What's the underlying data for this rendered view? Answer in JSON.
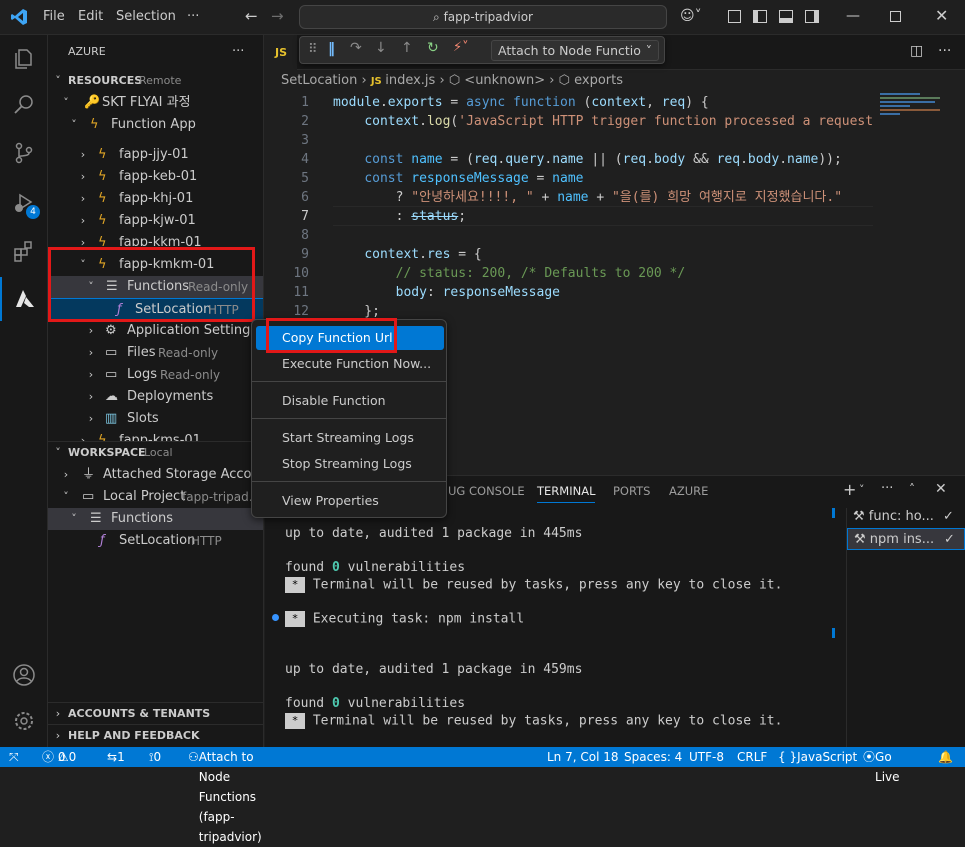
{
  "titlebar": {
    "menu": [
      "File",
      "Edit",
      "Selection",
      "···"
    ],
    "search": "fapp-tripadvior"
  },
  "activity": {
    "badge": "4"
  },
  "sidebar": {
    "title": "AZURE",
    "more": "···",
    "resources": {
      "label": "RESOURCES",
      "tag": "Remote"
    },
    "subscription": "SKT FLYAI 과정",
    "function_app": "Function App",
    "apps": [
      "fapp-jjy-01",
      "fapp-keb-01",
      "fapp-khj-01",
      "fapp-kjw-01",
      "fapp-kkm-01"
    ],
    "selected_app": "fapp-kmkm-01",
    "functions": {
      "label": "Functions",
      "tag": "Read-only"
    },
    "function_item": {
      "label": "SetLocation",
      "tag": "HTTP"
    },
    "app_children": [
      {
        "label": "Application Settings",
        "tag": ""
      },
      {
        "label": "Files",
        "tag": "Read-only"
      },
      {
        "label": "Logs",
        "tag": "Read-only"
      },
      {
        "label": "Deployments",
        "tag": ""
      },
      {
        "label": "Slots",
        "tag": ""
      }
    ],
    "partial_app": "fapp-kms-01",
    "workspace": {
      "label": "WORKSPACE",
      "tag": "Local"
    },
    "attached_storage": "Attached Storage Accou...",
    "local_project": {
      "label": "Local Project",
      "tag": "fapp-tripad..."
    },
    "ws_functions": "Functions",
    "ws_function_item": {
      "label": "SetLocation",
      "tag": "HTTP"
    },
    "accounts": "ACCOUNTS & TENANTS",
    "help": "HELP AND FEEDBACK"
  },
  "debug_toolbar": {
    "attach_label": "Attach to Node Functio"
  },
  "editor": {
    "tab_label": "JS",
    "breadcrumb": [
      "SetLocation",
      "index.js",
      "<unknown>",
      "exports"
    ],
    "line_numbers": [
      "1",
      "2",
      "3",
      "4",
      "5",
      "6",
      "7",
      "8",
      "9",
      "10",
      "11",
      "12"
    ]
  },
  "context_menu": {
    "items": [
      "Copy Function Url",
      "Execute Function Now...",
      "Disable Function",
      "Start Streaming Logs",
      "Stop Streaming Logs",
      "View Properties"
    ]
  },
  "panel": {
    "tabs": [
      "UG CONSOLE",
      "TERMINAL",
      "PORTS",
      "AZURE"
    ],
    "active_tab": "TERMINAL",
    "terminal_lines": {
      "l1": "up to date, audited 1 package in 445ms",
      "l2a": "found ",
      "l2b": "0",
      "l2c": " vulnerabilities",
      "l3": "Terminal will be reused by tasks, press any key to close it.",
      "l4": "Executing task: npm install",
      "l5": "up to date, audited 1 package in 459ms",
      "l6a": "found ",
      "l6b": "0",
      "l6c": " vulnerabilities",
      "l7": "Terminal will be reused by tasks, press any key to close it.",
      "star": "*"
    },
    "terminal_list": [
      "func: ho...",
      "npm ins..."
    ]
  },
  "statusbar": {
    "errors": "0",
    "warnings": "0",
    "branch": "1",
    "ports": "0",
    "attach": "Attach to Node Functions (fapp-tripadvior)",
    "position": "Ln 7, Col 18",
    "spaces": "Spaces: 4",
    "encoding": "UTF-8",
    "eol": "CRLF",
    "language": "JavaScript",
    "golive": "Go Live"
  },
  "colors": {
    "accent": "#0078d4",
    "highlight": "#e21818"
  }
}
